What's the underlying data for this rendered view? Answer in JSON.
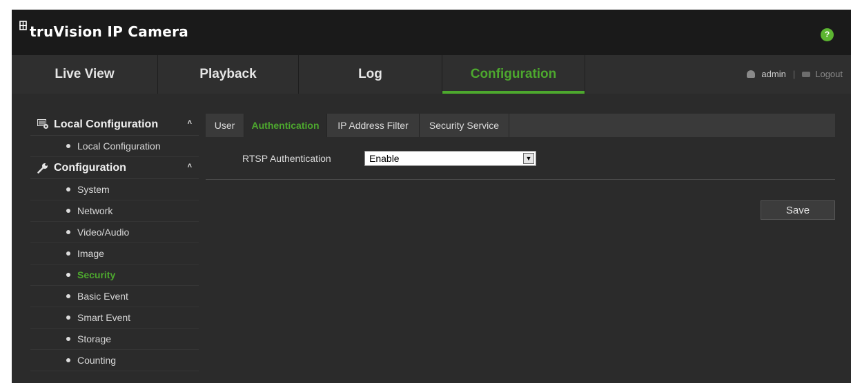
{
  "app": {
    "title": "truVision IP Camera",
    "help_label": "?"
  },
  "topnav": {
    "tabs": [
      {
        "label": "Live View"
      },
      {
        "label": "Playback"
      },
      {
        "label": "Log"
      },
      {
        "label": "Configuration",
        "active": true
      }
    ],
    "user": "admin",
    "separator": "|",
    "logout": "Logout"
  },
  "sidebar": {
    "groups": [
      {
        "label": "Local Configuration",
        "icon": "local-config-icon",
        "items": [
          {
            "label": "Local Configuration"
          }
        ]
      },
      {
        "label": "Configuration",
        "icon": "wrench-icon",
        "items": [
          {
            "label": "System"
          },
          {
            "label": "Network"
          },
          {
            "label": "Video/Audio"
          },
          {
            "label": "Image"
          },
          {
            "label": "Security",
            "active": true
          },
          {
            "label": "Basic Event"
          },
          {
            "label": "Smart Event"
          },
          {
            "label": "Storage"
          },
          {
            "label": "Counting"
          }
        ]
      }
    ]
  },
  "content": {
    "tabs": [
      {
        "label": "User"
      },
      {
        "label": "Authentication",
        "active": true
      },
      {
        "label": "IP Address Filter"
      },
      {
        "label": "Security Service"
      }
    ],
    "rtsp_label": "RTSP Authentication",
    "rtsp_value": "Enable",
    "save_label": "Save"
  },
  "colors": {
    "accent": "#4da82e",
    "background": "#2b2b2b",
    "header": "#1a1a1a"
  }
}
